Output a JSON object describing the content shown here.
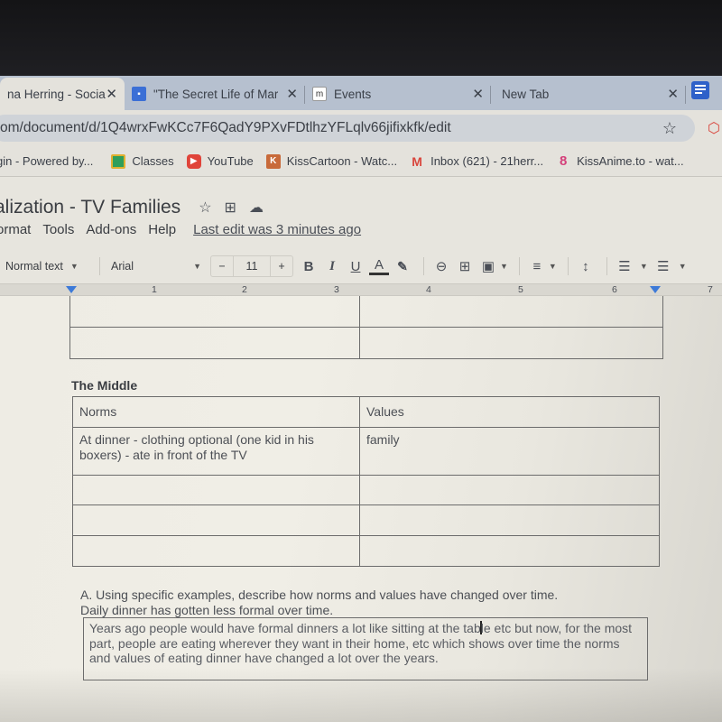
{
  "browser": {
    "tabs": [
      {
        "label": "na Herring - Socia",
        "active": true,
        "favicon": "docs-icon"
      },
      {
        "label": "\"The Secret Life of Mary",
        "active": false,
        "favicon": "classroom-icon"
      },
      {
        "label": "Events",
        "active": false,
        "favicon": "events-icon"
      },
      {
        "label": "New Tab",
        "active": false,
        "favicon": ""
      }
    ],
    "close_glyph": "✕",
    "url": "om/document/d/1Q4wrxFwKCc7F6QadY9PXvFDtlhzYFLqlv66jifixkfk/edit",
    "star_glyph": "☆",
    "bookmarks": [
      {
        "label": "gin - Powered by...",
        "icon": ""
      },
      {
        "label": "Classes",
        "icon": "classroom-icon"
      },
      {
        "label": "YouTube",
        "icon": "youtube-icon"
      },
      {
        "label": "KissCartoon - Watc...",
        "icon": "kisscartoon-icon"
      },
      {
        "label": "Inbox (621) - 21herr...",
        "icon": "gmail-icon"
      },
      {
        "label": "KissAnime.to - wat...",
        "icon": "kissanime-icon"
      }
    ]
  },
  "doc": {
    "title": "alization - TV Families",
    "menu": [
      "ormat",
      "Tools",
      "Add-ons",
      "Help"
    ],
    "last_edit": "Last edit was 3 minutes ago",
    "toolbar": {
      "style": "Normal text",
      "font": "Arial",
      "minus": "−",
      "size": "11",
      "plus": "+",
      "bold": "B",
      "italic": "I",
      "underline": "U",
      "text_color": "A"
    },
    "ruler": [
      "1",
      "2",
      "3",
      "4",
      "5",
      "6",
      "7"
    ]
  },
  "content": {
    "prev_table_rows": [
      [
        "",
        ""
      ],
      [
        "",
        ""
      ]
    ],
    "section_title": "The Middle",
    "table": {
      "headers": [
        "Norms",
        "Values"
      ],
      "rows": [
        [
          "At dinner - clothing optional (one kid in his boxers) - ate in front of the TV",
          "family"
        ],
        [
          "",
          ""
        ],
        [
          "",
          ""
        ],
        [
          "",
          ""
        ]
      ]
    },
    "question_line1": "A. Using specific examples, describe how norms and values have changed over time.",
    "question_line2": "Daily dinner has gotten less formal over time.",
    "answer_before_cursor": "Years ago people would have formal dinners a lot like sitting at the tab",
    "answer_after_cursor": "le etc but now, for the most part, people are eating wherever they want in their home, etc which shows over time the norms and values of eating dinner have changed a lot over the years."
  }
}
